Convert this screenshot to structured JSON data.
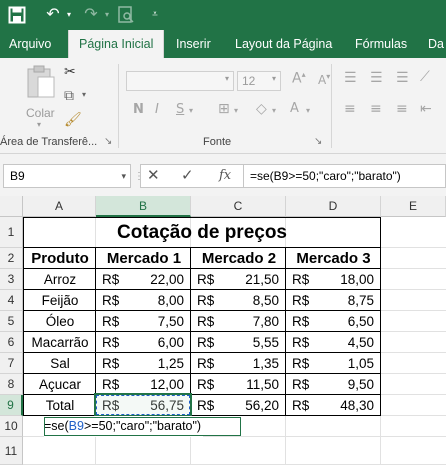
{
  "quick_access": {
    "save_icon": "save-icon",
    "undo_icon": "undo-icon",
    "redo_icon": "redo-icon",
    "preview_icon": "print-preview-icon",
    "customize_icon": "customize-qat-icon"
  },
  "ribbon_tabs": [
    "Arquivo",
    "Página Inicial",
    "Inserir",
    "Layout da Página",
    "Fórmulas",
    "Da"
  ],
  "active_tab": "Página Inicial",
  "ribbon": {
    "clipboard": {
      "paste_label": "Colar",
      "group_label": "Área de Transferê...",
      "launcher": "↘"
    },
    "font": {
      "font_name": "",
      "font_size": "12",
      "bold": "N",
      "italic": "I",
      "underline": "S",
      "group_label": "Fonte",
      "launcher": "↘"
    }
  },
  "formula_bar": {
    "name_box": "B9",
    "cancel": "✕",
    "enter": "✓",
    "fx": "fx",
    "formula": "=se(B9>=50;\"caro\";\"barato\")"
  },
  "grid": {
    "columns": [
      "A",
      "B",
      "C",
      "D",
      "E"
    ],
    "selected_column": "B",
    "rows": [
      "1",
      "2",
      "3",
      "4",
      "5",
      "6",
      "7",
      "8",
      "9",
      "10",
      "11"
    ],
    "selected_row": "9"
  },
  "sheet": {
    "title": "Cotação de preços",
    "headers": [
      "Produto",
      "Mercado 1",
      "Mercado 2",
      "Mercado 3"
    ],
    "currency": "R$",
    "products": [
      {
        "name": "Arroz",
        "m1": "22,00",
        "m2": "21,50",
        "m3": "18,00"
      },
      {
        "name": "Feijão",
        "m1": "8,00",
        "m2": "8,50",
        "m3": "8,75"
      },
      {
        "name": "Óleo",
        "m1": "7,50",
        "m2": "7,80",
        "m3": "6,50"
      },
      {
        "name": "Macarrão",
        "m1": "6,00",
        "m2": "5,55",
        "m3": "4,50"
      },
      {
        "name": "Sal",
        "m1": "1,25",
        "m2": "1,35",
        "m3": "1,05"
      },
      {
        "name": "Açucar",
        "m1": "12,00",
        "m2": "11,50",
        "m3": "9,50"
      },
      {
        "name": "Total",
        "m1": "56,75",
        "m2": "56,20",
        "m3": "48,30"
      }
    ],
    "edit_formula": {
      "prefix": "=se(",
      "ref": "B9",
      "rest": ">=50;\"caro\";\"barato\")"
    }
  },
  "colors": {
    "excel_green": "#217346",
    "ref_blue": "#1f5fc7",
    "selection_fill": "#d3e6da"
  }
}
